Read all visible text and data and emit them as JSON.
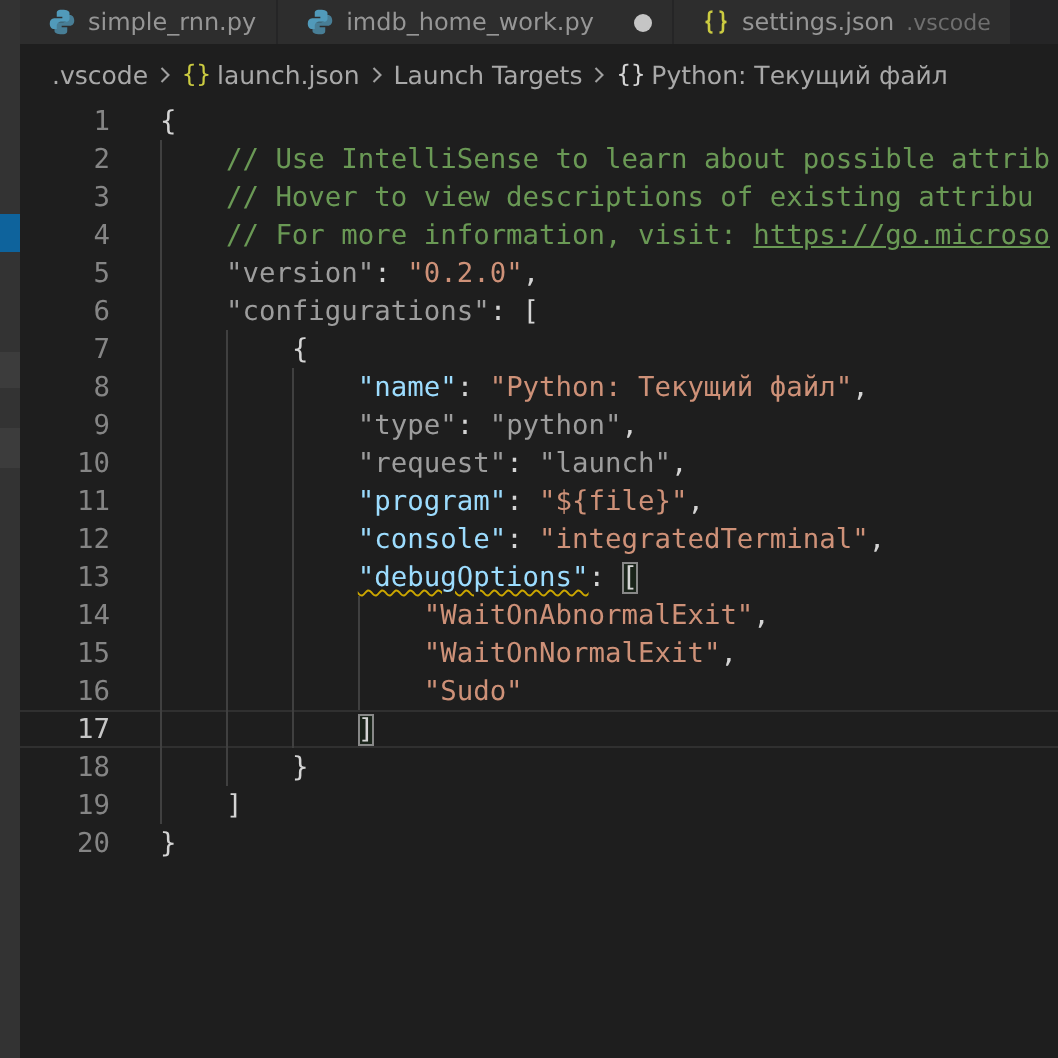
{
  "tabs": [
    {
      "label": "simple_rnn.py",
      "kind": "python",
      "selected": false,
      "dirty": false
    },
    {
      "label": "imdb_home_work.py",
      "kind": "python",
      "selected": false,
      "dirty": true
    },
    {
      "label": "settings.json",
      "kind": "json",
      "description": ".vscode",
      "selected": false,
      "dirty": false
    }
  ],
  "breadcrumbs": [
    {
      "label": ".vscode",
      "kind": "folder"
    },
    {
      "label": "launch.json",
      "icon": "{}",
      "kind": "file"
    },
    {
      "label": "Launch Targets",
      "kind": "section"
    },
    {
      "label": "Python: Текущий файл",
      "icon": "{}",
      "kind": "object"
    }
  ],
  "editor": {
    "lines": [
      {
        "number": "1",
        "current": false,
        "tokens": [
          {
            "kind": "punct",
            "t": "{"
          }
        ]
      },
      {
        "number": "2",
        "current": false,
        "tokens": [
          {
            "kind": "comment",
            "t": "    // Use IntelliSense to learn about possible attrib"
          }
        ]
      },
      {
        "number": "3",
        "current": false,
        "tokens": [
          {
            "kind": "comment",
            "t": "    // Hover to view descriptions of existing attribu"
          }
        ]
      },
      {
        "number": "4",
        "current": false,
        "tokens": [
          {
            "kind": "comment",
            "t": "    // For more information, visit: "
          },
          {
            "kind": "link",
            "t": "https://go.microso"
          }
        ]
      },
      {
        "number": "5",
        "current": false,
        "tokens": [
          {
            "kind": "key-muted",
            "t": "    \"version\""
          },
          {
            "kind": "punct",
            "t": ": "
          },
          {
            "kind": "string",
            "t": "\"0.2.0\""
          },
          {
            "kind": "punct",
            "t": ","
          }
        ]
      },
      {
        "number": "6",
        "current": false,
        "tokens": [
          {
            "kind": "key-muted",
            "t": "    \"configurations\""
          },
          {
            "kind": "punct",
            "t": ": ["
          }
        ]
      },
      {
        "number": "7",
        "current": false,
        "tokens": [
          {
            "kind": "punct",
            "t": "        {"
          }
        ]
      },
      {
        "number": "8",
        "current": false,
        "tokens": [
          {
            "kind": "key",
            "t": "            \"name\""
          },
          {
            "kind": "punct",
            "t": ": "
          },
          {
            "kind": "string",
            "t": "\"Python: Текущий файл\""
          },
          {
            "kind": "punct",
            "t": ","
          }
        ]
      },
      {
        "number": "9",
        "current": false,
        "tokens": [
          {
            "kind": "key-muted",
            "t": "            \"type\""
          },
          {
            "kind": "punct",
            "t": ": "
          },
          {
            "kind": "string-muted",
            "t": "\"python\""
          },
          {
            "kind": "punct",
            "t": ","
          }
        ]
      },
      {
        "number": "10",
        "current": false,
        "tokens": [
          {
            "kind": "key-muted",
            "t": "            \"request\""
          },
          {
            "kind": "punct",
            "t": ": "
          },
          {
            "kind": "string-muted",
            "t": "\"launch\""
          },
          {
            "kind": "punct",
            "t": ","
          }
        ]
      },
      {
        "number": "11",
        "current": false,
        "tokens": [
          {
            "kind": "key",
            "t": "            \"program\""
          },
          {
            "kind": "punct",
            "t": ": "
          },
          {
            "kind": "string",
            "t": "\"${file}\""
          },
          {
            "kind": "punct",
            "t": ","
          }
        ]
      },
      {
        "number": "12",
        "current": false,
        "tokens": [
          {
            "kind": "key",
            "t": "            \"console\""
          },
          {
            "kind": "punct",
            "t": ": "
          },
          {
            "kind": "string",
            "t": "\"integratedTerminal\""
          },
          {
            "kind": "punct",
            "t": ","
          }
        ]
      },
      {
        "number": "13",
        "current": false,
        "tokens": [
          {
            "kind": "key",
            "t": "            \"debugOptions\"",
            "warning": true
          },
          {
            "kind": "punct",
            "t": ": "
          },
          {
            "kind": "punct",
            "t": "[",
            "matched": true
          }
        ]
      },
      {
        "number": "14",
        "current": false,
        "tokens": [
          {
            "kind": "string",
            "t": "                \"WaitOnAbnormalExit\""
          },
          {
            "kind": "punct",
            "t": ","
          }
        ]
      },
      {
        "number": "15",
        "current": false,
        "tokens": [
          {
            "kind": "string",
            "t": "                \"WaitOnNormalExit\""
          },
          {
            "kind": "punct",
            "t": ","
          }
        ]
      },
      {
        "number": "16",
        "current": false,
        "tokens": [
          {
            "kind": "string",
            "t": "                \"Sudo\""
          }
        ]
      },
      {
        "number": "17",
        "current": true,
        "tokens": [
          {
            "kind": "punct",
            "t": "            ]",
            "matched": true
          }
        ]
      },
      {
        "number": "18",
        "current": false,
        "tokens": [
          {
            "kind": "punct",
            "t": "        }"
          }
        ]
      },
      {
        "number": "19",
        "current": false,
        "tokens": [
          {
            "kind": "punct",
            "t": "    ]"
          }
        ]
      },
      {
        "number": "20",
        "current": false,
        "tokens": [
          {
            "kind": "punct",
            "t": "}"
          }
        ]
      }
    ]
  }
}
